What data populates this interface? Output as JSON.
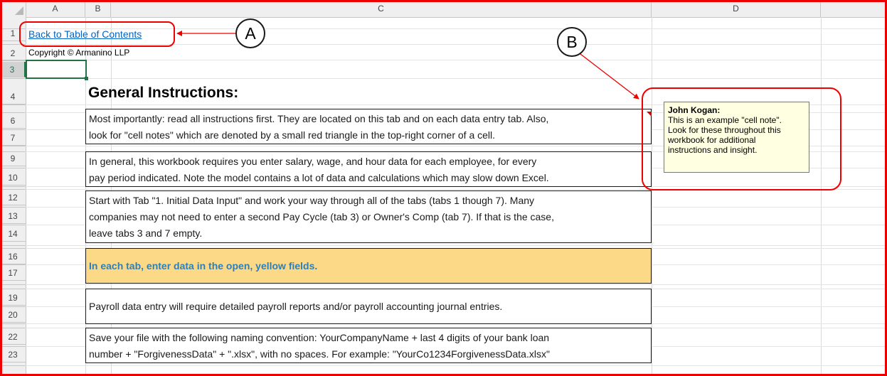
{
  "columns": [
    "A",
    "B",
    "C",
    "D"
  ],
  "rows": [
    "1",
    "2",
    "3",
    "4",
    "6",
    "7",
    "9",
    "10",
    "12",
    "13",
    "14",
    "16",
    "17",
    "19",
    "20",
    "22",
    "23"
  ],
  "cells": {
    "link": "Back to Table of Contents",
    "copyright": "Copyright © Armanino LLP",
    "heading": "General Instructions:"
  },
  "instructions": [
    {
      "lines": [
        "Most importantly: read all instructions first. They are located on this tab and on each data entry tab. Also,",
        "look for \"cell notes\" which are denoted by a small red triangle in the top-right corner of a cell."
      ]
    },
    {
      "lines": [
        "In general, this workbook requires you enter salary, wage, and hour data for each employee, for every",
        "pay period indicated. Note the model contains a lot of data and calculations which may slow down Excel."
      ]
    },
    {
      "lines": [
        "Start with Tab \"1. Initial Data Input\" and work your way through all of the tabs (tabs 1 though 7). Many",
        "companies may not need to enter a second Pay Cycle (tab 3) or Owner's Comp (tab 7). If that is the case,",
        "leave tabs 3 and 7 empty."
      ]
    },
    {
      "lines": [
        "In each tab, enter data in the open, yellow fields."
      ]
    },
    {
      "lines": [
        "Payroll data entry will require detailed payroll reports and/or payroll accounting journal entries."
      ]
    },
    {
      "lines": [
        "Save your file with the following naming convention: YourCompanyName + last 4 digits of your bank loan",
        "number + \"ForgivenessData\" + \".xlsx\", with no spaces. For example: \"YourCo1234ForgivenessData.xlsx\""
      ]
    }
  ],
  "note": {
    "author": "John Kogan:",
    "lines": [
      "This is an example \"cell note\".",
      "Look for these throughout this",
      "workbook for additional",
      "instructions and insight."
    ]
  },
  "callouts": {
    "a": "A",
    "b": "B"
  },
  "colors": {
    "highlight_fill": "#fcd986",
    "highlight_text": "#2e7fb8",
    "link": "#0563c1",
    "annotation_red": "#ee0000",
    "selection_green": "#217346"
  }
}
